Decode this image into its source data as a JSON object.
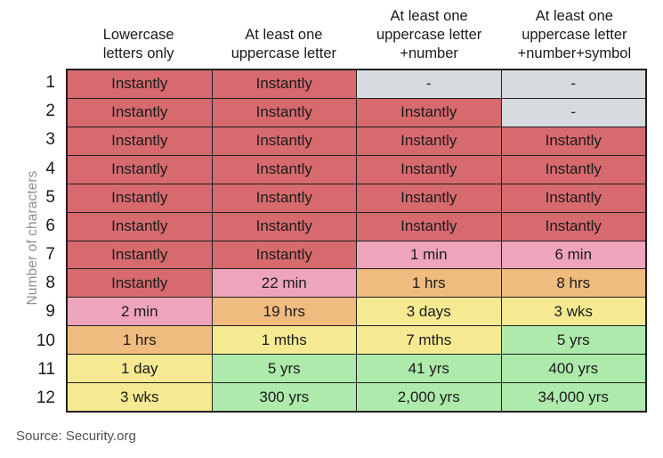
{
  "axis": {
    "y_title": "Number of characters"
  },
  "source": {
    "text": "Source: Security.org"
  },
  "colors": {
    "red": "#d66a6e",
    "pink": "#eea5bc",
    "orange": "#f0bb7e",
    "yellow": "#f5ea92",
    "green": "#aeeaab",
    "gray": "#d5dbdf",
    "grid_line": "#231f20",
    "axis_label": "#8a8f94",
    "source_text": "#4c5156"
  },
  "chart_data": {
    "type": "heatmap",
    "title": "",
    "subtitle": "",
    "xlabel": "",
    "ylabel": "Number of characters",
    "legend_position": "none",
    "grid": true,
    "column_header_lines": [
      [
        "Lowercase",
        "letters only"
      ],
      [
        "At least one",
        "uppercase letter"
      ],
      [
        "At least one",
        "uppercase letter",
        "+number"
      ],
      [
        "At least one",
        "uppercase letter",
        "+number+symbol"
      ]
    ],
    "categories": [
      "Lowercase letters only",
      "At least one uppercase letter",
      "At least one uppercase letter +number",
      "At least one uppercase letter +number+symbol"
    ],
    "row_labels": [
      "1",
      "2",
      "3",
      "4",
      "5",
      "6",
      "7",
      "8",
      "9",
      "10",
      "11",
      "12"
    ],
    "rows": [
      {
        "label": "1",
        "cells": [
          {
            "text": "Instantly",
            "color": "#d66a6e"
          },
          {
            "text": "Instantly",
            "color": "#d66a6e"
          },
          {
            "text": "-",
            "color": "#d5dbdf"
          },
          {
            "text": "-",
            "color": "#d5dbdf"
          }
        ]
      },
      {
        "label": "2",
        "cells": [
          {
            "text": "Instantly",
            "color": "#d66a6e"
          },
          {
            "text": "Instantly",
            "color": "#d66a6e"
          },
          {
            "text": "Instantly",
            "color": "#d66a6e"
          },
          {
            "text": "-",
            "color": "#d5dbdf"
          }
        ]
      },
      {
        "label": "3",
        "cells": [
          {
            "text": "Instantly",
            "color": "#d66a6e"
          },
          {
            "text": "Instantly",
            "color": "#d66a6e"
          },
          {
            "text": "Instantly",
            "color": "#d66a6e"
          },
          {
            "text": "Instantly",
            "color": "#d66a6e"
          }
        ]
      },
      {
        "label": "4",
        "cells": [
          {
            "text": "Instantly",
            "color": "#d66a6e"
          },
          {
            "text": "Instantly",
            "color": "#d66a6e"
          },
          {
            "text": "Instantly",
            "color": "#d66a6e"
          },
          {
            "text": "Instantly",
            "color": "#d66a6e"
          }
        ]
      },
      {
        "label": "5",
        "cells": [
          {
            "text": "Instantly",
            "color": "#d66a6e"
          },
          {
            "text": "Instantly",
            "color": "#d66a6e"
          },
          {
            "text": "Instantly",
            "color": "#d66a6e"
          },
          {
            "text": "Instantly",
            "color": "#d66a6e"
          }
        ]
      },
      {
        "label": "6",
        "cells": [
          {
            "text": "Instantly",
            "color": "#d66a6e"
          },
          {
            "text": "Instantly",
            "color": "#d66a6e"
          },
          {
            "text": "Instantly",
            "color": "#d66a6e"
          },
          {
            "text": "Instantly",
            "color": "#d66a6e"
          }
        ]
      },
      {
        "label": "7",
        "cells": [
          {
            "text": "Instantly",
            "color": "#d66a6e"
          },
          {
            "text": "Instantly",
            "color": "#d66a6e"
          },
          {
            "text": "1 min",
            "color": "#eea5bc"
          },
          {
            "text": "6 min",
            "color": "#eea5bc"
          }
        ]
      },
      {
        "label": "8",
        "cells": [
          {
            "text": "Instantly",
            "color": "#d66a6e"
          },
          {
            "text": "22 min",
            "color": "#eea5bc"
          },
          {
            "text": "1 hrs",
            "color": "#f0bb7e"
          },
          {
            "text": "8 hrs",
            "color": "#f0bb7e"
          }
        ]
      },
      {
        "label": "9",
        "cells": [
          {
            "text": "2 min",
            "color": "#eea5bc"
          },
          {
            "text": "19 hrs",
            "color": "#f0bb7e"
          },
          {
            "text": "3 days",
            "color": "#f5ea92"
          },
          {
            "text": "3 wks",
            "color": "#f5ea92"
          }
        ]
      },
      {
        "label": "10",
        "cells": [
          {
            "text": "1 hrs",
            "color": "#f0bb7e"
          },
          {
            "text": "1 mths",
            "color": "#f5ea92"
          },
          {
            "text": "7 mths",
            "color": "#f5ea92"
          },
          {
            "text": "5 yrs",
            "color": "#aeeaab"
          }
        ]
      },
      {
        "label": "11",
        "cells": [
          {
            "text": "1 day",
            "color": "#f5ea92"
          },
          {
            "text": "5 yrs",
            "color": "#aeeaab"
          },
          {
            "text": "41 yrs",
            "color": "#aeeaab"
          },
          {
            "text": "400 yrs",
            "color": "#aeeaab"
          }
        ]
      },
      {
        "label": "12",
        "cells": [
          {
            "text": "3 wks",
            "color": "#f5ea92"
          },
          {
            "text": "300 yrs",
            "color": "#aeeaab"
          },
          {
            "text": "2,000 yrs",
            "color": "#aeeaab"
          },
          {
            "text": "34,000 yrs",
            "color": "#aeeaab"
          }
        ]
      }
    ]
  }
}
